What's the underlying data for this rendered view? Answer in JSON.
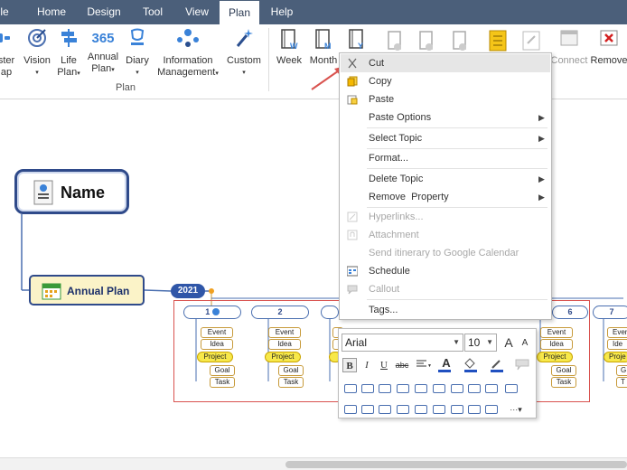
{
  "tabs": [
    "le",
    "Home",
    "Design",
    "Tool",
    "View",
    "Plan",
    "Help"
  ],
  "active_tab": "Plan",
  "ribbon": {
    "group_plan_label": "Plan",
    "buttons": {
      "master_map": [
        "ster",
        "ap"
      ],
      "vision": "Vision",
      "life_plan": [
        "Life",
        "Plan"
      ],
      "annual_plan": [
        "Annual",
        "Plan"
      ],
      "annual_number": "365",
      "diary": "Diary",
      "info_mgmt": [
        "Information",
        "Management"
      ],
      "custom": "Custom",
      "week": "Week",
      "month": "Month",
      "connect": "Connect",
      "remove": "Remove"
    },
    "week_letter": "W",
    "month_letter": "M",
    "y_letter": "Y"
  },
  "canvas": {
    "name_topic": "Name",
    "plan_topic": "Annual Plan",
    "year_badge": "2021",
    "months": [
      "1",
      "2",
      "6",
      "7"
    ],
    "subtopics": {
      "event": "Event",
      "idea": "Idea",
      "project": "Project",
      "goal": "Goal",
      "task": "Task",
      "event_cut": "Even",
      "idea_cut": "Ide",
      "project_cut": "Proje",
      "goal_cut": "G",
      "task_cut": "T"
    }
  },
  "context_menu": {
    "items": [
      {
        "label": "Cut",
        "state": "hover"
      },
      {
        "label": "Copy"
      },
      {
        "label": "Paste"
      },
      {
        "label": "Paste Options",
        "submenu": true
      },
      {
        "label": "Select Topic",
        "submenu": true
      },
      {
        "label": "Format..."
      },
      {
        "label": "Delete Topic",
        "submenu": true
      },
      {
        "label": "Remove  Property",
        "submenu": true
      },
      {
        "label": "Hyperlinks...",
        "state": "disabled"
      },
      {
        "label": "Attachment",
        "state": "disabled"
      },
      {
        "label": "Send itinerary to Google Calendar",
        "state": "disabled"
      },
      {
        "label": "Schedule"
      },
      {
        "label": "Callout",
        "state": "disabled"
      },
      {
        "label": "Tags..."
      }
    ]
  },
  "format_bar": {
    "font": "Arial",
    "size": "10",
    "grow": "A",
    "shrink": "A",
    "bold": "B",
    "italic": "I",
    "underline": "U",
    "strike": "abc",
    "font_color_glyph": "A"
  },
  "colors": {
    "tabbar": "#4b5f7a",
    "accent_blue": "#2f4a8a",
    "highlight_yellow": "#f7e84a",
    "selection_red": "#d9534f"
  }
}
